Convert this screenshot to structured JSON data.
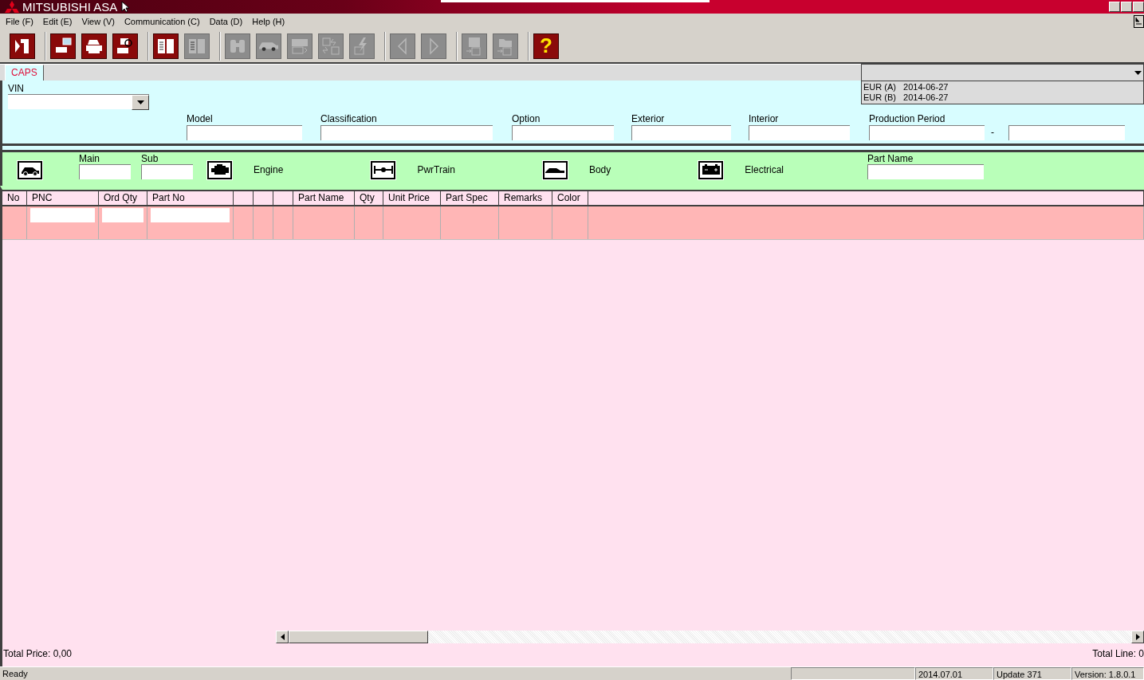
{
  "window": {
    "title": "MITSUBISHI ASA"
  },
  "menu": [
    "File (F)",
    "Edit (E)",
    "View (V)",
    "Communication (C)",
    "Data (D)",
    "Help (H)"
  ],
  "toolbar": [
    [
      {
        "kind": "exit",
        "enabled": true
      }
    ],
    [
      {
        "kind": "printscreen",
        "enabled": true
      },
      {
        "kind": "printer",
        "enabled": true
      },
      {
        "kind": "preview",
        "enabled": true
      }
    ],
    [
      {
        "kind": "book",
        "enabled": true
      },
      {
        "kind": "book",
        "enabled": false
      }
    ],
    [
      {
        "kind": "binoculars",
        "enabled": false
      },
      {
        "kind": "car",
        "enabled": false
      },
      {
        "kind": "pnc",
        "enabled": false
      },
      {
        "kind": "swap",
        "enabled": false
      },
      {
        "kind": "lightning",
        "enabled": false
      }
    ],
    [
      {
        "kind": "left",
        "enabled": false
      },
      {
        "kind": "right",
        "enabled": false
      }
    ],
    [
      {
        "kind": "save",
        "enabled": false
      },
      {
        "kind": "open",
        "enabled": false
      }
    ],
    [
      {
        "kind": "help",
        "enabled": true,
        "label": "?"
      }
    ]
  ],
  "tabs": [
    {
      "label": "CAPS",
      "selected": true
    }
  ],
  "catalog_list": [
    "EUR (A)   2014-06-27",
    "EUR (B)   2014-06-27"
  ],
  "vin": {
    "label": "VIN"
  },
  "filters": [
    {
      "label": "Model"
    },
    {
      "label": "Classification"
    },
    {
      "label": "Option"
    },
    {
      "label": "Exterior"
    },
    {
      "label": "Interior"
    },
    {
      "label": "Production Period",
      "range_separator": "-"
    }
  ],
  "groups": [
    {
      "kind": "car"
    },
    {
      "kind": "field",
      "label": "Main"
    },
    {
      "kind": "field",
      "label": "Sub"
    },
    {
      "kind": "engine",
      "label": "Engine"
    },
    {
      "kind": "axle",
      "label": "PwrTrain"
    },
    {
      "kind": "body",
      "label": "Body"
    },
    {
      "kind": "battery",
      "label": "Electrical"
    },
    {
      "kind": "field",
      "label": "Part Name"
    }
  ],
  "table": {
    "columns": [
      {
        "label": "No",
        "editable": false
      },
      {
        "label": "PNC",
        "editable": true
      },
      {
        "label": "Ord Qty",
        "editable": true
      },
      {
        "label": "Part No",
        "editable": true
      },
      {
        "editable": false
      },
      {
        "editable": false
      },
      {
        "editable": false
      },
      {
        "label": "Part Name",
        "editable": false
      },
      {
        "label": "Qty",
        "editable": false
      },
      {
        "label": "Unit Price",
        "editable": false
      },
      {
        "label": "Part Spec",
        "editable": false
      },
      {
        "label": "Remarks",
        "editable": false
      },
      {
        "label": "Color",
        "editable": false
      }
    ]
  },
  "total_price": "Total Price: 0,00",
  "total_line": "Total Line: 0",
  "status_bar": [
    "Ready",
    "2014.07.01",
    "Update 371",
    "Version: 1.8.0.1"
  ]
}
